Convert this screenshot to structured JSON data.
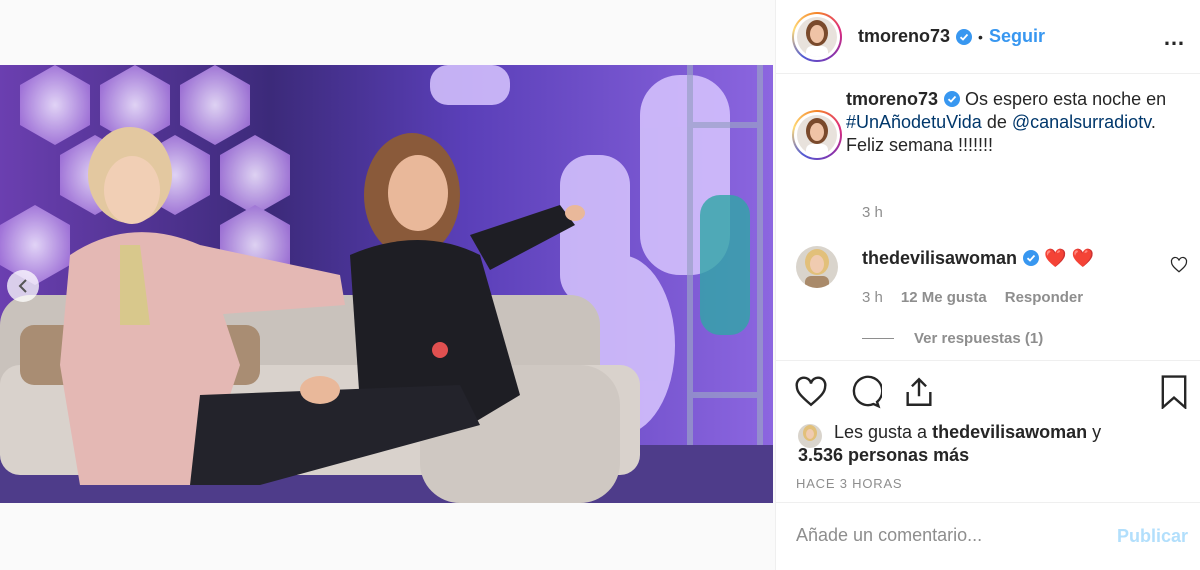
{
  "header": {
    "username": "tmoreno73",
    "separator": "•",
    "follow_label": "Seguir",
    "more_icon": "…"
  },
  "caption": {
    "username": "tmoreno73",
    "text_1": "Os espero esta noche en",
    "hashtag": "#UnAñodetuVida",
    "text_2": "de",
    "mention": "@canalsurradiotv",
    "text_3": ". Feliz semana !!!!!!!",
    "time": "3 h"
  },
  "comment": {
    "username": "thedevilisawoman",
    "text": "❤️ ❤️",
    "time": "3 h",
    "likes": "12 Me gusta",
    "reply_label": "Responder",
    "view_replies": "Ver respuestas (1)"
  },
  "likes": {
    "prefix": "Les gusta a",
    "user": "thedevilisawoman",
    "suffix": "y",
    "others": "3.536 personas más"
  },
  "timestamp": "HACE 3 HORAS",
  "add_comment": {
    "placeholder": "Añade un comentario...",
    "publish_label": "Publicar"
  },
  "colors": {
    "link": "#00376b",
    "follow": "#3897f0",
    "verified": "#3897f0",
    "publish_disabled": "#b2dffc"
  }
}
